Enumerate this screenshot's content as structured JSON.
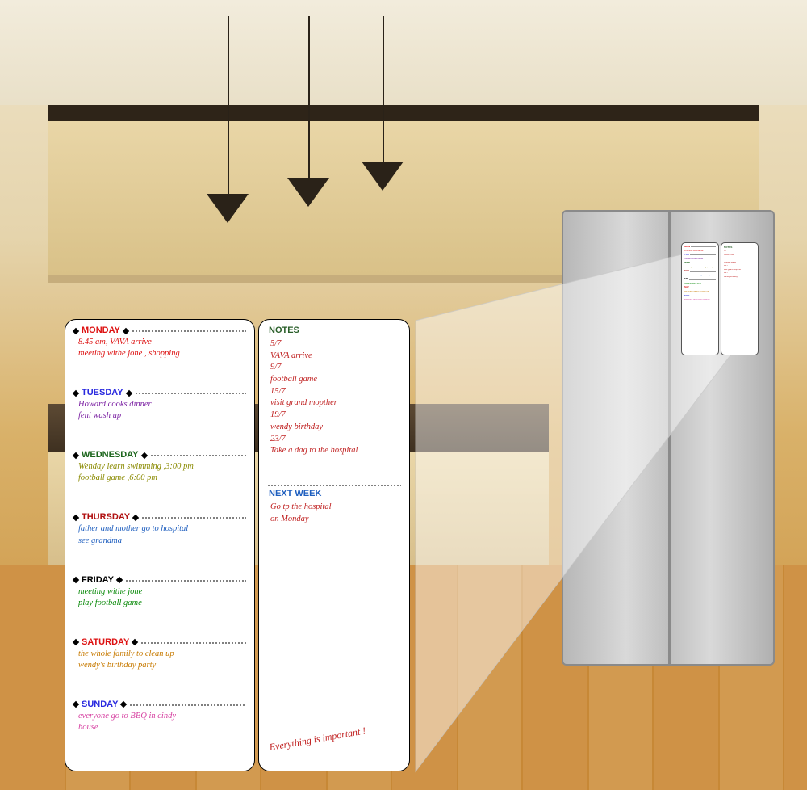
{
  "planner": {
    "days": [
      {
        "name": "MONDAY",
        "color": "#d11",
        "lines": [
          "8.45 am, VAVA arrive",
          "meeting withe jone ,  shopping"
        ],
        "lineColor": "#d11"
      },
      {
        "name": "TUESDAY",
        "color": "#2a2adf",
        "lines": [
          "Howard cooks dinner",
          "feni wash up"
        ],
        "lineColor": "#7a1fa2"
      },
      {
        "name": "WEDNESDAY",
        "color": "#1b651b",
        "lines": [
          "Wenday learn swimming ,3:00 pm",
          "football game ,6:00 pm"
        ],
        "lineColor": "#8a8a00"
      },
      {
        "name": "THURSDAY",
        "color": "#b01010",
        "lines": [
          "father and mother go to hospital",
          "see grandma"
        ],
        "lineColor": "#1f5fbf"
      },
      {
        "name": "FRIDAY",
        "color": "#000",
        "lines": [
          "meeting withe jone",
          "play football game"
        ],
        "lineColor": "#0a8a0a"
      },
      {
        "name": "SATURDAY",
        "color": "#d11",
        "lines": [
          "the whole family to clean up",
          "wendy's birthday party"
        ],
        "lineColor": "#c77a00"
      },
      {
        "name": "SUNDAY",
        "color": "#2a2adf",
        "lines": [
          "everyone go to  BBQ  in cindy",
          "house"
        ],
        "lineColor": "#d63fa0"
      }
    ],
    "notes": {
      "heading": "NOTES",
      "lines": [
        "5/7",
        "VAVA  arrive",
        "9/7",
        "football  game",
        "15/7",
        "visit grand mopther",
        "19/7",
        "wendy birthday",
        "23/7",
        "Take a dag to the hospital"
      ],
      "color": "#c02020"
    },
    "nextWeek": {
      "heading": "NEXT WEEK",
      "lines": [
        "Go tp the hospital",
        "on Monday"
      ],
      "color": "#c02020"
    },
    "tagline": "Everything is important !"
  }
}
